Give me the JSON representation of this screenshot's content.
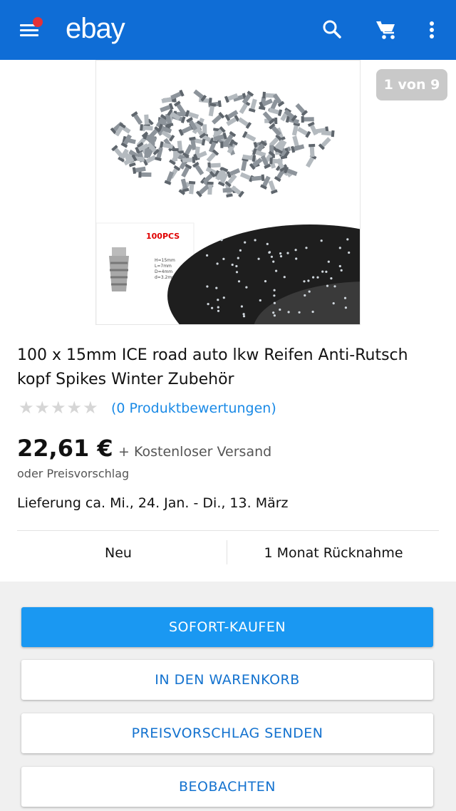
{
  "header": {
    "logo": "ebay",
    "icons": [
      "menu-icon",
      "search-icon",
      "cart-icon",
      "more-vert-icon"
    ],
    "brand_color": "#0f6dd6",
    "notification_color": "#e53238"
  },
  "gallery": {
    "counter": "1 von 9",
    "inset_label": "100PCS",
    "spec_lines": [
      "H=15mm",
      "L=7mm",
      "D=4mm",
      "d=3.2mm"
    ]
  },
  "product": {
    "title": "100 x 15mm ICE road auto lkw Reifen Anti-Rutsch kopf Spikes Winter Zubehör",
    "rating": 0,
    "stars": "★★★★★",
    "reviews": "(0 Produktbewertungen)",
    "price": "22,61 €",
    "shipping": "+ Kostenloser Versand",
    "offer": "oder Preisvorschlag",
    "delivery": "Lieferung ca. Mi., 24. Jan. - Di., 13. März",
    "condition": "Neu",
    "returns": "1 Monat Rücknahme"
  },
  "actions": {
    "buy_now": "SOFORT-KAUFEN",
    "add_to_cart": "IN DEN WARENKORB",
    "make_offer": "PREISVORSCHLAG SENDEN",
    "watch": "BEOBACHTEN"
  },
  "colors": {
    "primary_button": "#1a98f2",
    "link": "#1a8ae6",
    "secondary_text": "#1372cf"
  }
}
